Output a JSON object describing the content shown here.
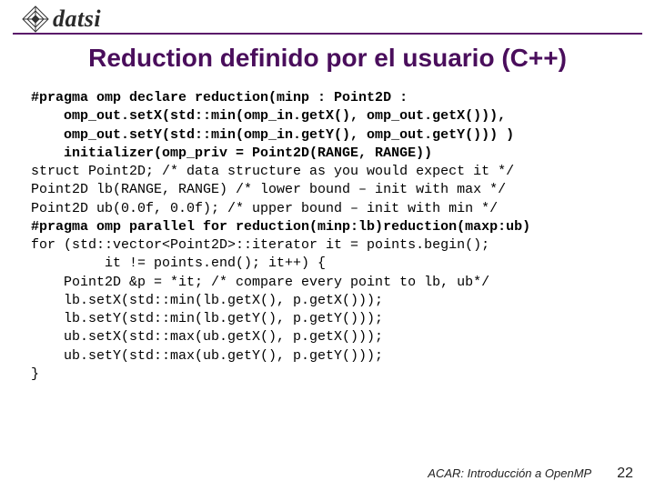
{
  "header": {
    "logo_text": "datsi"
  },
  "title": "Reduction definido por el usuario (C++)",
  "code": {
    "l01a": "#pragma omp declare reduction(minp : Point2D :",
    "l02": "    omp_out.setX(std::min(omp_in.getX(), omp_out.getX())),",
    "l03": "    omp_out.setY(std::min(omp_in.getY(), omp_out.getY())) )",
    "l04": "    initializer(omp_priv = Point2D(RANGE, RANGE))",
    "l05": "struct Point2D; /* data structure as you would expect it */",
    "l06": "Point2D lb(RANGE, RANGE) /* lower bound – init with max */",
    "l07": "Point2D ub(0.0f, 0.0f); /* upper bound – init with min */",
    "l08a": "#pragma omp parallel for reduction(minp:lb)reduction(maxp:ub)",
    "l09": "for (std::vector<Point2D>::iterator it = points.begin();",
    "l10": "         it != points.end(); it++) {",
    "l11": "    Point2D &p = *it; /* compare every point to lb, ub*/",
    "l12": "    lb.setX(std::min(lb.getX(), p.getX()));",
    "l13": "    lb.setY(std::min(lb.getY(), p.getY()));",
    "l14": "    ub.setX(std::max(ub.getX(), p.getX()));",
    "l15": "    ub.setY(std::max(ub.getY(), p.getY()));",
    "l16": "}"
  },
  "footer": {
    "text": "ACAR: Introducción a OpenMP",
    "page": "22"
  },
  "colors": {
    "accent": "#4a0e5c"
  }
}
